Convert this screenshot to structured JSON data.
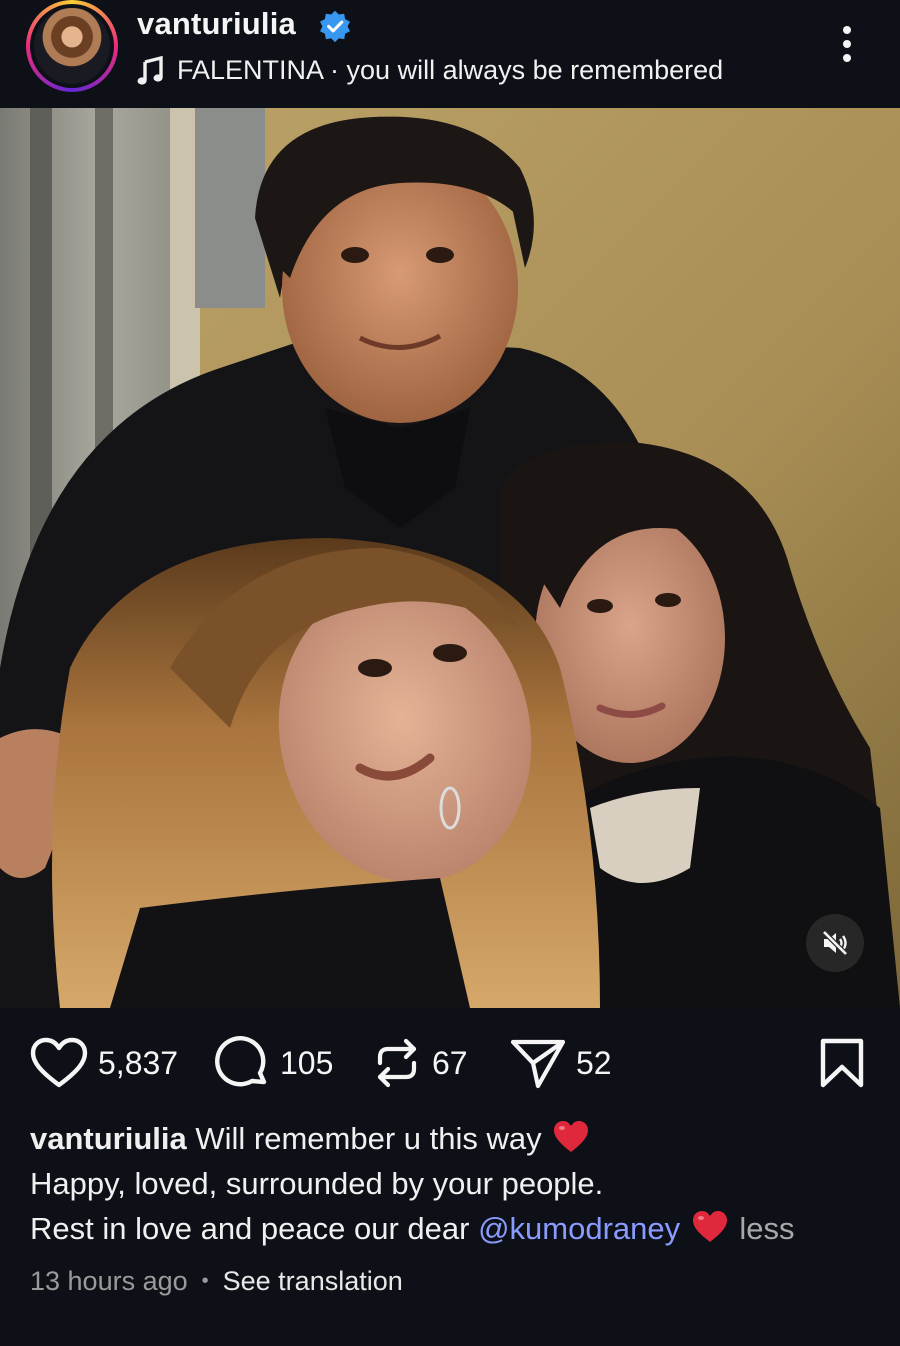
{
  "post": {
    "username": "vanturiulia",
    "verified": true,
    "music_text": "FALENTINA · you will always be remembered",
    "icons": {
      "more": "more-vertical-icon",
      "music": "music-note-icon",
      "verified": "verified-badge-icon",
      "mute": "speaker-muted-icon"
    }
  },
  "actions": {
    "likes": "5,837",
    "comments": "105",
    "reposts": "67",
    "shares": "52",
    "icons": [
      "heart-icon",
      "comment-icon",
      "repost-icon",
      "send-icon",
      "bookmark-icon"
    ]
  },
  "caption": {
    "username": "vanturiulia",
    "line1": "Will remember u this way",
    "line2": "Happy, loved, surrounded by your people.",
    "line3_prefix": "Rest in love and peace our dear",
    "mention": "@kumodraney",
    "less": "less"
  },
  "meta": {
    "time": "13 hours ago",
    "translate": "See translation"
  },
  "colors": {
    "background": "#0d1117",
    "mention": "#8a9bff",
    "verified": "#3897f0",
    "heart_emoji": "#e0283c"
  }
}
